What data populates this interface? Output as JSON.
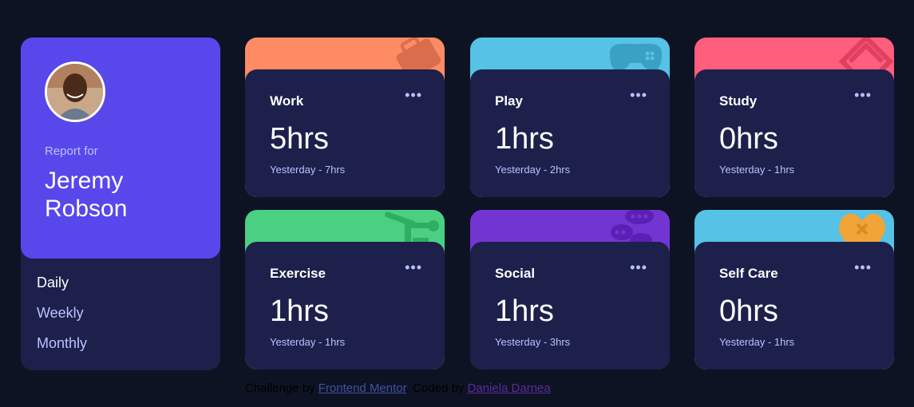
{
  "profile": {
    "report_for": "Report for",
    "name": "Jeremy Robson",
    "periods": [
      "Daily",
      "Weekly",
      "Monthly"
    ],
    "active_period": "Daily"
  },
  "cards": [
    {
      "title": "Work",
      "hours": "5hrs",
      "previous": "Yesterday - 7hrs",
      "color": "#ff8b64",
      "icon": "briefcase-icon"
    },
    {
      "title": "Play",
      "hours": "1hrs",
      "previous": "Yesterday - 2hrs",
      "color": "#55c2e6",
      "icon": "gamepad-icon"
    },
    {
      "title": "Study",
      "hours": "0hrs",
      "previous": "Yesterday - 1hrs",
      "color": "#ff5e7d",
      "icon": "books-icon"
    },
    {
      "title": "Exercise",
      "hours": "1hrs",
      "previous": "Yesterday - 1hrs",
      "color": "#4bcf82",
      "icon": "runner-icon"
    },
    {
      "title": "Social",
      "hours": "1hrs",
      "previous": "Yesterday - 3hrs",
      "color": "#7335d2",
      "icon": "chat-icon"
    },
    {
      "title": "Self Care",
      "hours": "0hrs",
      "previous": "Yesterday - 1hrs",
      "color": "#55c2e6",
      "icon": "heart-icon"
    }
  ],
  "menu_label": "•••",
  "footer": {
    "prefix": "Challenge by ",
    "link1": "Frontend Mentor",
    "middle": ". Coded by ",
    "link2": "Daniela Darnea"
  }
}
